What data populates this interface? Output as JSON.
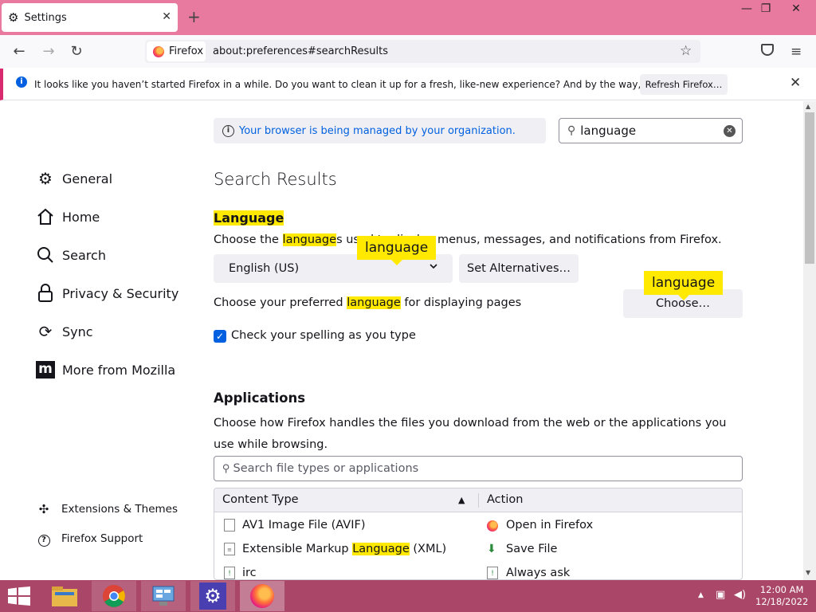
{
  "window": {
    "tab_title": "Settings",
    "tab_close": "✕",
    "new_tab": "+",
    "controls": [
      "—",
      "❐",
      "✕"
    ]
  },
  "nav": {
    "back": "←",
    "forward": "→",
    "reload": "↻",
    "identity_label": "Firefox",
    "url": "about:preferences#searchResults",
    "bookmark_star": "☆",
    "menu": "≡"
  },
  "notification": {
    "icon": "i",
    "text": "It looks like you haven’t started Firefox in a while. Do you want to clean it up for a fresh, like-new experience? And by the way, welcome back!",
    "button": "Refresh Firefox…",
    "close": "✕"
  },
  "sidebar": {
    "items": [
      {
        "label": "General",
        "icon": "gear-icon"
      },
      {
        "label": "Home",
        "icon": "home-icon"
      },
      {
        "label": "Search",
        "icon": "search-icon"
      },
      {
        "label": "Privacy & Security",
        "icon": "lock-icon"
      },
      {
        "label": "Sync",
        "icon": "sync-icon"
      },
      {
        "label": "More from Mozilla",
        "icon": "mozilla-icon"
      }
    ],
    "footer": [
      {
        "label": "Extensions & Themes",
        "icon": "puzzle-icon"
      },
      {
        "label": "Firefox Support",
        "icon": "help-icon"
      }
    ]
  },
  "main": {
    "managed_notice": "Your browser is being managed by your organization.",
    "search_value": "language",
    "results_title": "Search Results",
    "language": {
      "heading": "Language",
      "desc_pre": "Choose the ",
      "desc_hl": "language",
      "desc_mid": "s used ",
      "desc_hidden": "to display me",
      "desc_post": "nus, messages, and notifications from Firefox.",
      "tooltip": "language",
      "selected": "English (US)",
      "alternatives_button": "Set Alternatives…",
      "pref_pre": "Choose your preferred ",
      "pref_hl": "language",
      "pref_post": " for displaying pages",
      "choose_button": "Choose…",
      "choose_tooltip": "language",
      "spell_label": "Check your spelling as you type",
      "spell_checked": true
    },
    "applications": {
      "heading": "Applications",
      "desc": "Choose how Firefox handles the files you download from the web or the applications you use while browsing.",
      "search_placeholder": "Search file types or applications",
      "col_content": "Content Type",
      "col_action": "Action",
      "rows": [
        {
          "pre": "AV1 Image File (AVIF)",
          "hl": "",
          "post": "",
          "action": "Open in Firefox"
        },
        {
          "pre": "Extensible Markup ",
          "hl": "Language",
          "post": " (XML)",
          "action": "Save File"
        },
        {
          "pre": "irc",
          "hl": "",
          "post": "",
          "action": "Always ask"
        }
      ]
    }
  },
  "taskbar": {
    "time": "12:00 AM",
    "date": "12/18/2022"
  },
  "colors": {
    "titlebar": "#e8799f",
    "taskbar": "#aa4667",
    "highlight": "#ffe900",
    "accent": "#0060df"
  }
}
